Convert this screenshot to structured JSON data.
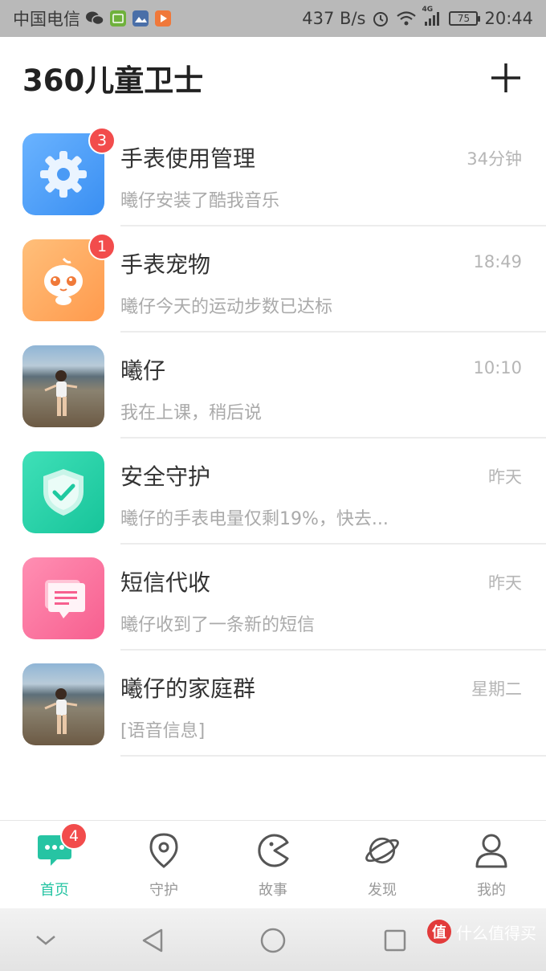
{
  "status_bar": {
    "carrier": "中国电信",
    "net_speed": "437 B/s",
    "network": "4G",
    "battery": "75",
    "time": "20:44",
    "colors": {
      "bg": "#b9b9b9",
      "fg": "#3a3a3a"
    }
  },
  "header": {
    "title": "360儿童卫士"
  },
  "chats": [
    {
      "title": "手表使用管理",
      "preview": "曦仔安装了酷我音乐",
      "time": "34分钟",
      "badge": "3",
      "icon": "gear-icon"
    },
    {
      "title": "手表宠物",
      "preview": "曦仔今天的运动步数已达标",
      "time": "18:49",
      "badge": "1",
      "icon": "pet-icon"
    },
    {
      "title": "曦仔",
      "preview": "我在上课，稍后说",
      "time": "10:10",
      "icon": "child-photo"
    },
    {
      "title": "安全守护",
      "preview": "曦仔的手表电量仅剩19%，快去...",
      "time": "昨天",
      "icon": "shield-check-icon"
    },
    {
      "title": "短信代收",
      "preview": "曦仔收到了一条新的短信",
      "time": "昨天",
      "icon": "message-icon"
    },
    {
      "title": "曦仔的家庭群",
      "preview": "[语音信息]",
      "time": "星期二",
      "icon": "child-photo"
    }
  ],
  "tabs": [
    {
      "label": "首页",
      "icon": "chat-bubble-icon",
      "badge": "4",
      "active": true
    },
    {
      "label": "守护",
      "icon": "location-pin-icon"
    },
    {
      "label": "故事",
      "icon": "pacman-icon"
    },
    {
      "label": "发现",
      "icon": "planet-icon"
    },
    {
      "label": "我的",
      "icon": "person-icon"
    }
  ],
  "watermark": {
    "logo": "值",
    "text": "什么值得买"
  },
  "colors": {
    "accent": "#26c4a3",
    "badge": "#f24c4c",
    "muted_text": "#aaaaaa"
  }
}
